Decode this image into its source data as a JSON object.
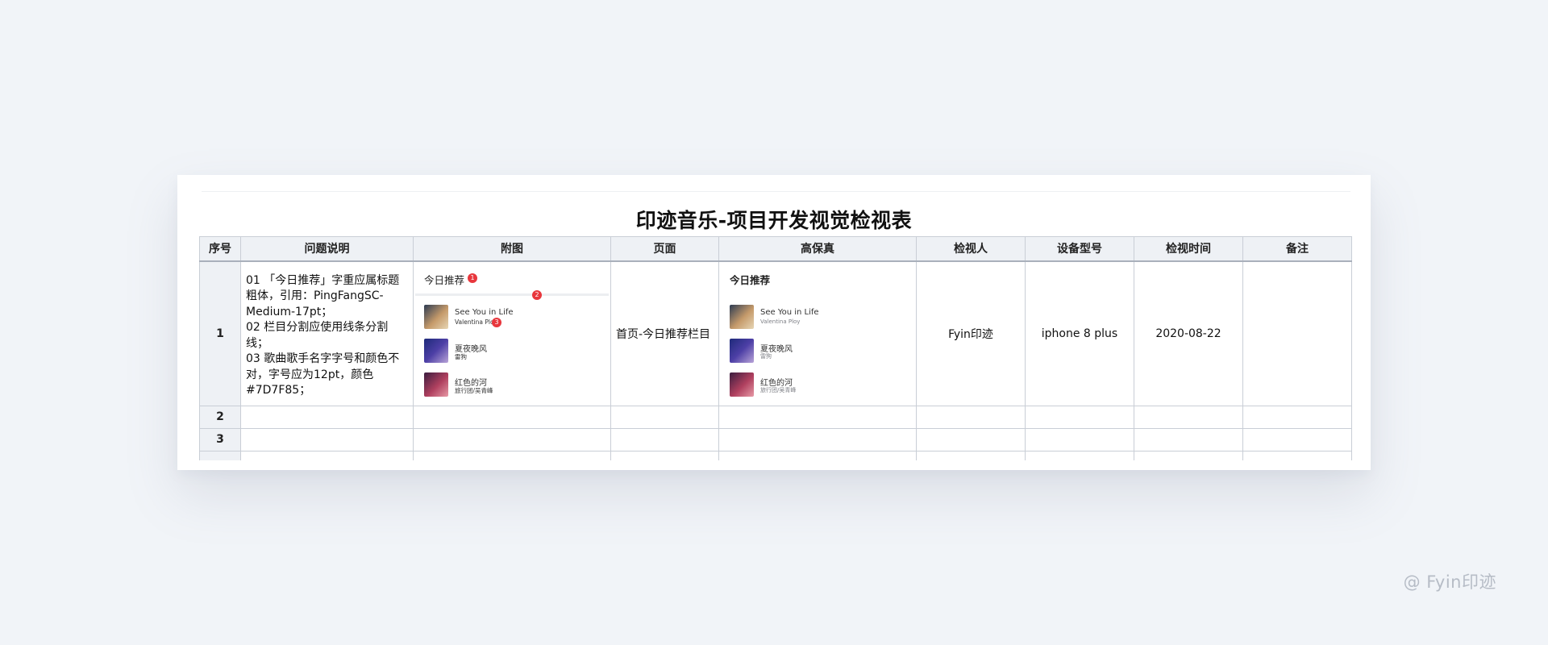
{
  "title": "印迹音乐-项目开发视觉检视表",
  "headers": [
    "序号",
    "问题说明",
    "附图",
    "页面",
    "高保真",
    "检视人",
    "设备型号",
    "检视时间",
    "备注"
  ],
  "rows": [
    {
      "index": "1",
      "description": [
        "01 「今日推荐」字重应属标题粗体，引用：PingFangSC-Medium-17pt；",
        "02 栏目分割应使用线条分割线；",
        "03 歌曲歌手名字字号和颜色不对，字号应为12pt，颜色#7D7F85；"
      ],
      "page": "首页-今日推荐栏目",
      "reviewer": "Fyin印迹",
      "device": "iphone 8 plus",
      "date": "2020-08-22",
      "remark": ""
    },
    {
      "index": "2"
    },
    {
      "index": "3"
    }
  ],
  "attachment": {
    "heading": "今日推荐",
    "badges": [
      "1",
      "2",
      "3"
    ],
    "songs": [
      {
        "name": "See You in Life",
        "artist": "Valentina Ploy"
      },
      {
        "name": "夏夜晚风",
        "artist": "雷狗"
      },
      {
        "name": "红色的河",
        "artist": "旅行团/吴青峰"
      }
    ]
  },
  "hifi": {
    "heading": "今日推荐",
    "songs": [
      {
        "name": "See You in Life",
        "artist": "Valentina Ploy"
      },
      {
        "name": "夏夜晚风",
        "artist": "雷狗"
      },
      {
        "name": "红色的河",
        "artist": "旅行团/吴青峰"
      }
    ]
  },
  "colors": {
    "badge": "#e8373d",
    "artist_spec": "#7D7F85",
    "header_bg": "#eef1f5",
    "page_bg": "#f1f4f8"
  },
  "watermark": "@ Fyin印迹"
}
